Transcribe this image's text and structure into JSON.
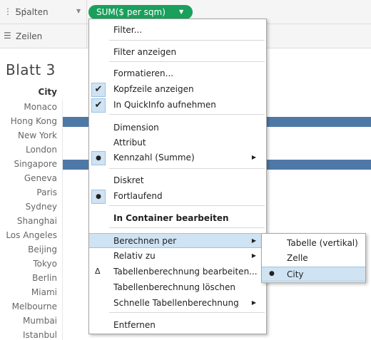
{
  "shelves": {
    "columns_label": "Spalten",
    "rows_label": "Zeilen",
    "pill_label": "SUM($ per sqm)"
  },
  "sheet": {
    "title": "Blatt 3",
    "city_header": "City",
    "cities": [
      "Monaco",
      "Hong Kong",
      "New York",
      "London",
      "Singapore",
      "Geneva",
      "Paris",
      "Sydney",
      "Shanghai",
      "Los Angeles",
      "Beijing",
      "Tokyo",
      "Berlin",
      "Miami",
      "Melbourne",
      "Mumbai",
      "Istanbul"
    ],
    "bar_color": "#4e79a7",
    "visible_bars": [
      "Hong Kong",
      "Singapore"
    ]
  },
  "context_menu": {
    "items": [
      {
        "label": "Filter..."
      },
      {
        "label": "Filter anzeigen"
      },
      {
        "label": "Formatieren..."
      },
      {
        "label": "Kopfzeile anzeigen",
        "state": "checked"
      },
      {
        "label": "In QuickInfo aufnehmen",
        "state": "checked"
      },
      {
        "label": "Dimension"
      },
      {
        "label": "Attribut"
      },
      {
        "label": "Kennzahl (Summe)",
        "state": "selected",
        "submenu": true
      },
      {
        "label": "Diskret"
      },
      {
        "label": "Fortlaufend",
        "state": "selected"
      },
      {
        "label": "In Container bearbeiten",
        "bold": true
      },
      {
        "label": "Berechnen per",
        "submenu": true,
        "highlighted": true
      },
      {
        "label": "Relativ zu",
        "submenu": true
      },
      {
        "label": "Tabellenberechnung bearbeiten...",
        "icon": "delta-icon"
      },
      {
        "label": "Tabellenberechnung löschen"
      },
      {
        "label": "Schnelle Tabellenberechnung",
        "submenu": true
      },
      {
        "label": "Entfernen"
      }
    ]
  },
  "sub_menu": {
    "items": [
      {
        "label": "Tabelle (vertikal)"
      },
      {
        "label": "Zelle"
      },
      {
        "label": "City",
        "state": "selected"
      }
    ]
  }
}
